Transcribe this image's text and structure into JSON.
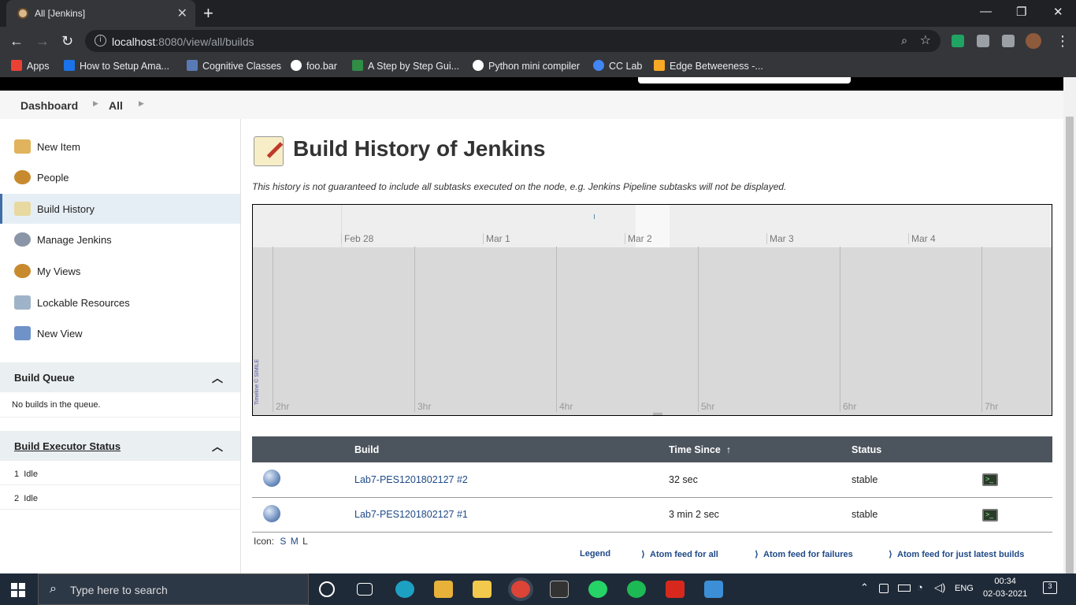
{
  "browser": {
    "tab_title": "All [Jenkins]",
    "url_host": "localhost",
    "url_rest": ":8080/view/all/builds",
    "bookmarks": [
      {
        "label": "Apps",
        "color": "#e94235"
      },
      {
        "label": "How to Setup Ama...",
        "color": "#1a73e8"
      },
      {
        "label": "Cognitive Classes",
        "color": "#5a7ab5"
      },
      {
        "label": "foo.bar",
        "color": "#ffffff"
      },
      {
        "label": "A Step by Step Gui...",
        "color": "#2f8d46"
      },
      {
        "label": "Python mini compiler",
        "color": "#ffffff"
      },
      {
        "label": "CC Lab",
        "color": "#4285f4"
      },
      {
        "label": "Edge Betweeness -...",
        "color": "#f9a825"
      }
    ]
  },
  "breadcrumb": {
    "items": [
      "Dashboard",
      "All"
    ]
  },
  "sidebar": {
    "tasks": [
      {
        "label": "New Item",
        "icon": "new-item-icon",
        "color": "#e0b35c"
      },
      {
        "label": "People",
        "icon": "people-icon",
        "color": "#c78a2e"
      },
      {
        "label": "Build History",
        "icon": "build-history-icon",
        "color": "#e8d9a0"
      },
      {
        "label": "Manage Jenkins",
        "icon": "gear-icon",
        "color": "#8a96a8"
      },
      {
        "label": "My Views",
        "icon": "my-views-icon",
        "color": "#c78a2e"
      },
      {
        "label": "Lockable Resources",
        "icon": "lockable-resources-icon",
        "color": "#9fb3c8"
      },
      {
        "label": "New View",
        "icon": "folder-icon",
        "color": "#6f93c8"
      }
    ],
    "build_queue": {
      "title": "Build Queue",
      "empty_text": "No builds in the queue."
    },
    "executors": {
      "title": "Build Executor Status",
      "rows": [
        {
          "num": "1",
          "status": "Idle"
        },
        {
          "num": "2",
          "status": "Idle"
        }
      ]
    }
  },
  "main": {
    "title": "Build History of Jenkins",
    "note": "This history is not guaranteed to include all subtasks executed on the node, e.g. Jenkins Pipeline subtasks will not be displayed.",
    "timeline": {
      "days": [
        "Feb 28",
        "Mar 1",
        "Mar 2",
        "Mar 3",
        "Mar 4"
      ],
      "hours": [
        "2hr",
        "3hr",
        "4hr",
        "5hr",
        "6hr",
        "7hr"
      ],
      "credit": "Timeline © SIMILE"
    },
    "table": {
      "headers": {
        "build": "Build",
        "time": "Time Since",
        "sort": "↑",
        "status": "Status"
      },
      "rows": [
        {
          "build": "Lab7-PES1201802127 #2",
          "time": "32 sec",
          "status": "stable"
        },
        {
          "build": "Lab7-PES1201802127 #1",
          "time": "3 min 2 sec",
          "status": "stable"
        }
      ]
    },
    "icon_size": {
      "label": "Icon:",
      "small": "S",
      "medium": "M",
      "large": "L"
    },
    "feeds": {
      "legend": "Legend",
      "all": "Atom feed for all",
      "failures": "Atom feed for failures",
      "latest": "Atom feed for just latest builds"
    }
  },
  "taskbar": {
    "search_placeholder": "Type here to search",
    "lang": "ENG",
    "time": "00:34",
    "date": "02-03-2021",
    "notifications": "3"
  }
}
